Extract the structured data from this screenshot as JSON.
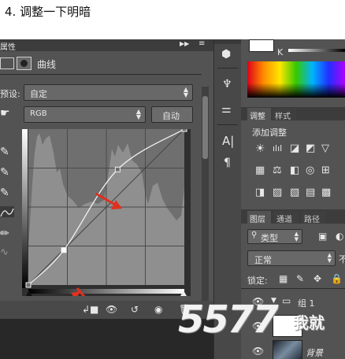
{
  "step_title": "4. 调整一下明暗",
  "properties_panel": {
    "tab_label": "属性",
    "panel_title": "曲线",
    "preset_label": "预设:",
    "preset_value": "自定",
    "channel_value": "RGB",
    "auto_button": "自动"
  },
  "curve": {
    "points": [
      {
        "input": 0,
        "output": 0
      },
      {
        "input": 58,
        "output": 57
      },
      {
        "input": 146,
        "output": 189
      },
      {
        "input": 255,
        "output": 255
      }
    ]
  },
  "color_panel": {
    "k_label": "K"
  },
  "adjustments_panel": {
    "tabs": [
      "调整",
      "样式"
    ],
    "title": "添加调整"
  },
  "layers_panel": {
    "tabs": [
      "图层",
      "通道",
      "路径"
    ],
    "filter_type": "类型",
    "blend_mode": "正常",
    "lock_label": "锁定:",
    "layers": [
      {
        "name": "组 1"
      },
      {
        "name": "背景"
      }
    ]
  },
  "watermark": {
    "number": "5577",
    "text": "我就"
  },
  "colors": {
    "panel_bg": "#535353",
    "histogram": "#8e8e8e",
    "arrow": "#e0301e"
  }
}
